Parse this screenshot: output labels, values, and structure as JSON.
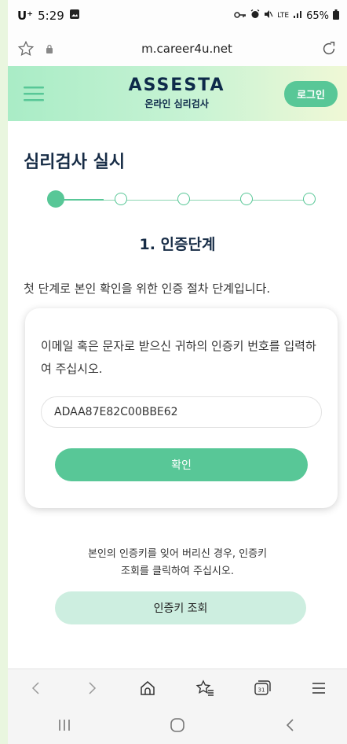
{
  "status": {
    "carrier": "U⁺",
    "time": "5:29",
    "signal": "LTE",
    "battery": "65%"
  },
  "browser": {
    "url": "m.career4u.net"
  },
  "header": {
    "logo": "ASSESTA",
    "logo_sub": "온라인 심리검사",
    "login": "로그인"
  },
  "page": {
    "title": "심리검사 실시",
    "step_heading": "1. 인증단계",
    "intro": "첫 단계로 본인 확인을 위한 인증 절차 단계입니다.",
    "card_text": "이메일 혹은 문자로 받으신 귀하의 인증키 번호를 입력하여 주십시오.",
    "key_value": "ADAA87E82C00BBE62",
    "confirm": "확인",
    "note_line1": "본인의 인증키를 잊어 버리신 경우, 인증키",
    "note_line2": "조회를 클릭하여 주십시오.",
    "lookup": "인증키 조회"
  },
  "stepper": {
    "total_steps": 5,
    "current_step": 1
  },
  "colors": {
    "accent": "#58c797",
    "navy": "#172c46",
    "lookup_bg": "#cdeee0"
  }
}
